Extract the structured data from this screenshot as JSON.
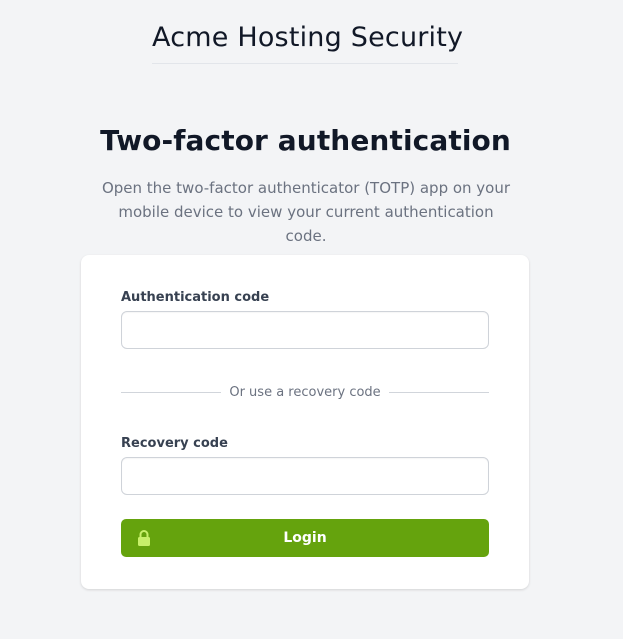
{
  "brand": {
    "title": "Acme Hosting Security"
  },
  "heading": {
    "title": "Two-factor authentication",
    "subtitle": "Open the two-factor authenticator (TOTP) app on your mobile device to view your current authentication code."
  },
  "form": {
    "auth_code": {
      "label": "Authentication code",
      "value": "",
      "placeholder": ""
    },
    "divider_text": "Or use a recovery code",
    "recovery_code": {
      "label": "Recovery code",
      "value": "",
      "placeholder": ""
    },
    "submit": {
      "label": "Login",
      "icon": "lock-icon"
    }
  },
  "colors": {
    "background": "#f3f4f6",
    "card": "#ffffff",
    "primary_button": "#65a30d",
    "heading_text": "#111827",
    "muted_text": "#6b7280"
  }
}
